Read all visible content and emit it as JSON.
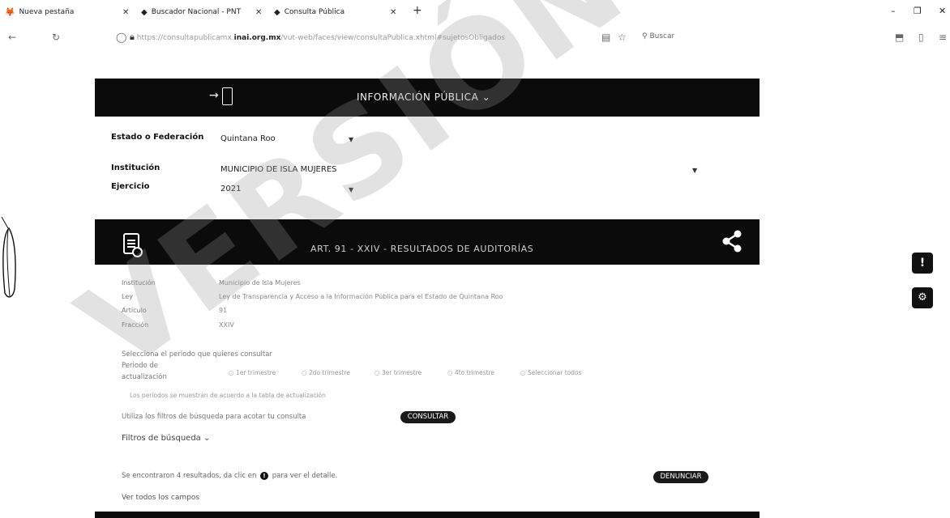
{
  "browser": {
    "tabs": [
      {
        "label": "Nueva pestaña",
        "icon": "firefox-icon"
      },
      {
        "label": "Buscador Nacional - PNT",
        "icon": "pnt-icon"
      },
      {
        "label": "Consulta Pública",
        "icon": "pnt-icon"
      }
    ],
    "new_tab": "+",
    "url_prefix": "https://consultapublicamx.",
    "url_domain": "inai.org.mx",
    "url_suffix": "/vut-web/faces/view/consultaPublica.xhtml#sujetosObligados",
    "search_placeholder": "Buscar"
  },
  "banner": {
    "title": "INFORMACIÓN PÚBLICA ⌄"
  },
  "filters": {
    "estado_label": "Estado o Federación",
    "estado_value": "Quintana Roo",
    "institucion_label": "Institución",
    "institucion_value": "MUNICIPIO DE ISLA MUJERES",
    "ejercicio_label": "Ejercicio",
    "ejercicio_value": "2021"
  },
  "section": {
    "title": "ART. 91 - XXIV - RESULTADOS DE AUDITORÍAS"
  },
  "info": {
    "institucion_label": "Institución",
    "institucion_value": "Municipio de Isla Mujeres",
    "ley_label": "Ley",
    "ley_value": "Ley de Transparencia y Acceso a la Información Pública para el Estado de Quintana Roo",
    "articulo_label": "Artículo",
    "articulo_value": "91",
    "fraccion_label": "Fracción",
    "fraccion_value": "XXIV"
  },
  "periodo": {
    "instruction": "Selecciona el periodo que quieres consultar",
    "label_line1": "Periodo de",
    "label_line2": "actualización",
    "options": [
      "1er trimestre",
      "2do trimestre",
      "3er trimestre",
      "4to trimestre",
      "Seleccionar todos"
    ],
    "note": "Los periodos se muestran de acuerdo a la tabla de actualización",
    "search_hint": "Utiliza los filtros de búsqueda para acotar tu consulta",
    "consultar": "CONSULTAR"
  },
  "filtros_busqueda": "Filtros de búsqueda ⌄",
  "results": {
    "count_text_before": "Se encontraron 4 resultados, da clic en",
    "count_text_after": "para ver el detalle.",
    "denunciar": "DENUNCIAR",
    "ver_campos": "Ver todos los campos"
  },
  "watermark": "VERSIÓN PÚ"
}
